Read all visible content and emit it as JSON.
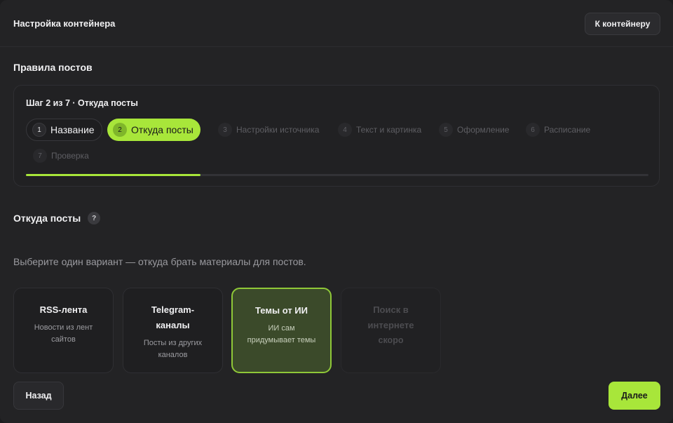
{
  "header": {
    "title": "Настройка контейнера",
    "to_container_label": "К контейнеру"
  },
  "rules": {
    "title": "Правила постов",
    "step_caption": "Шаг 2 из 7 · Откуда посты",
    "progress_fraction": 0.28,
    "steps": [
      {
        "num": "1",
        "label": "Название",
        "state": "done"
      },
      {
        "num": "2",
        "label": "Откуда посты",
        "state": "active"
      },
      {
        "num": "3",
        "label": "Настройки источника",
        "state": "pending"
      },
      {
        "num": "4",
        "label": "Текст и картинка",
        "state": "pending"
      },
      {
        "num": "5",
        "label": "Оформление",
        "state": "pending"
      },
      {
        "num": "6",
        "label": "Расписание",
        "state": "pending"
      },
      {
        "num": "7",
        "label": "Проверка",
        "state": "pending"
      }
    ]
  },
  "source": {
    "title": "Откуда посты",
    "help_icon": "?",
    "hint": "Выберите один вариант — откуда брать материалы для постов.",
    "options": [
      {
        "title_l1": "RSS-лента",
        "title_l2": "",
        "desc_l1": "Новости из лент",
        "desc_l2": "сайтов",
        "state": "normal"
      },
      {
        "title_l1": "Telegram-",
        "title_l2": "каналы",
        "desc_l1": "Посты из других",
        "desc_l2": "каналов",
        "state": "normal"
      },
      {
        "title_l1": "Темы от ИИ",
        "title_l2": "",
        "desc_l1": "ИИ сам",
        "desc_l2": "придумывает темы",
        "state": "selected"
      },
      {
        "title_l1": "Поиск в",
        "title_l2": "интернете",
        "desc_l1": "скоро",
        "desc_l2": "",
        "state": "disabled"
      }
    ]
  },
  "footer": {
    "back_label": "Назад",
    "next_label": "Далее"
  },
  "colors": {
    "accent": "#a8e63a",
    "background": "#232325",
    "selected_card": "#3b4a2a"
  }
}
